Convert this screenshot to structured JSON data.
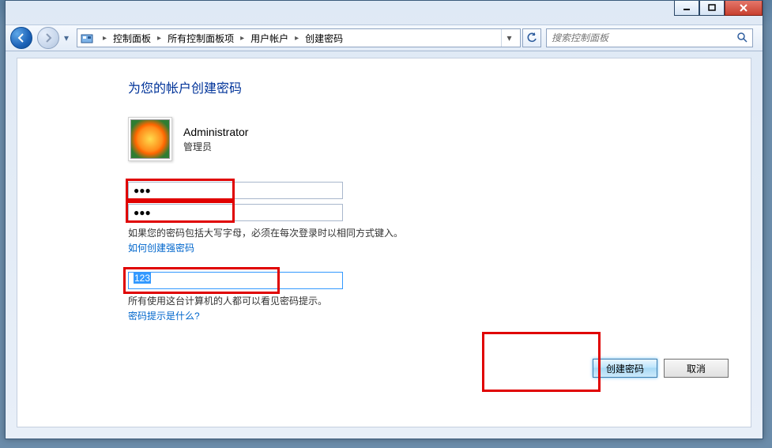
{
  "nav": {
    "breadcrumbs": [
      "控制面板",
      "所有控制面板项",
      "用户帐户",
      "创建密码"
    ]
  },
  "search": {
    "placeholder": "搜索控制面板"
  },
  "page": {
    "title": "为您的帐户创建密码"
  },
  "account": {
    "name": "Administrator",
    "role": "管理员"
  },
  "fields": {
    "password_value": "●●●",
    "confirm_value": "●●●",
    "caps_warning": "如果您的密码包括大写字母，必须在每次登录时以相同方式键入。",
    "strong_pw_link": "如何创建强密码",
    "hint_value": "123",
    "hint_info": "所有使用这台计算机的人都可以看见密码提示。",
    "hint_link": "密码提示是什么?"
  },
  "buttons": {
    "create": "创建密码",
    "cancel": "取消"
  }
}
